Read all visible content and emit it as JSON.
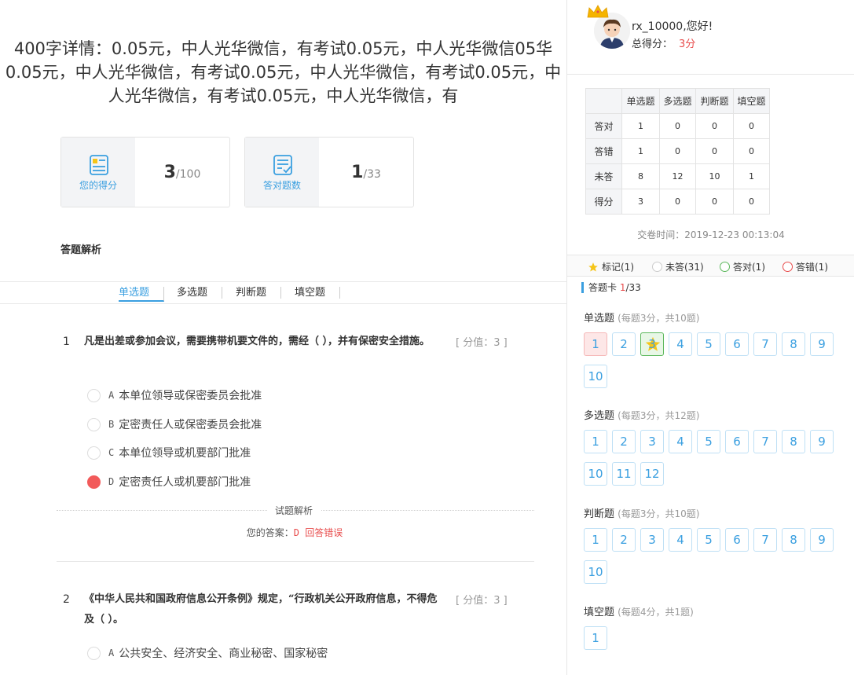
{
  "title": "400字详情：0.05元，中人光华微信，有考试0.05元，中人光华微信05华0.05元，中人光华微信，有考试0.05元，中人光华微信，有考试0.05元，中人光华微信，有考试0.05元，中人光华微信，有",
  "stats": {
    "score": {
      "label": "您的得分",
      "value": "3",
      "total": "/100",
      "icon": "document-icon"
    },
    "correct": {
      "label": "答对题数",
      "value": "1",
      "total": "/33",
      "icon": "checklist-icon"
    }
  },
  "section_title": "答题解析",
  "tabs": [
    "单选题",
    "多选题",
    "判断题",
    "填空题"
  ],
  "questions": [
    {
      "num": "1",
      "text": "凡是出差或参加会议，需要携带机要文件的，需经（ ），并有保密安全措施。",
      "score": "[ 分值：3 ]",
      "options": [
        {
          "letter": "A",
          "text": "本单位领导或保密委员会批准",
          "selected": false
        },
        {
          "letter": "B",
          "text": "定密责任人或保密委员会批准",
          "selected": false
        },
        {
          "letter": "C",
          "text": "本单位领导或机要部门批准",
          "selected": false
        },
        {
          "letter": "D",
          "text": "定密责任人或机要部门批准",
          "selected": true
        }
      ],
      "analysis_label": "试题解析",
      "answer_prefix": "您的答案：",
      "answer_value": "D 回答错误"
    },
    {
      "num": "2",
      "text": "《中华人民共和国政府信息公开条例》规定，“行政机关公开政府信息，不得危及（ ）。",
      "score": "[ 分值：3 ]",
      "options": [
        {
          "letter": "A",
          "text": "公共安全、经济安全、商业秘密、国家秘密",
          "selected": false
        }
      ]
    }
  ],
  "user": {
    "greeting": "rx_10000,您好!",
    "total_label": "总得分：",
    "total_value": "3分"
  },
  "score_table": {
    "headers": [
      "",
      "单选题",
      "多选题",
      "判断题",
      "填空题"
    ],
    "rows": [
      {
        "label": "答对",
        "values": [
          "1",
          "0",
          "0",
          "0"
        ]
      },
      {
        "label": "答错",
        "values": [
          "1",
          "0",
          "0",
          "0"
        ]
      },
      {
        "label": "未答",
        "values": [
          "8",
          "12",
          "10",
          "1"
        ]
      },
      {
        "label": "得分",
        "values": [
          "3",
          "0",
          "0",
          "0"
        ]
      }
    ]
  },
  "submit_time": "交卷时间：2019-12-23 00:13:04",
  "legend": {
    "marked": "标记(1)",
    "unanswered": "未答(31)",
    "correct": "答对(1)",
    "wrong": "答错(1)"
  },
  "answer_card": {
    "label": "答题卡",
    "count": "1",
    "total": "/33"
  },
  "groups": [
    {
      "name": "单选题",
      "sub": "(每题3分，共10题)",
      "items": [
        "1",
        "2",
        "3",
        "4",
        "5",
        "6",
        "7",
        "8",
        "9",
        "10"
      ]
    },
    {
      "name": "多选题",
      "sub": "(每题3分，共12题)",
      "items": [
        "1",
        "2",
        "3",
        "4",
        "5",
        "6",
        "7",
        "8",
        "9",
        "10",
        "11",
        "12"
      ]
    },
    {
      "name": "判断题",
      "sub": "(每题3分，共10题)",
      "items": [
        "1",
        "2",
        "3",
        "4",
        "5",
        "6",
        "7",
        "8",
        "9",
        "10"
      ]
    },
    {
      "name": "填空题",
      "sub": "(每题4分，共1题)",
      "items": [
        "1"
      ]
    }
  ],
  "colors": {
    "accent": "#3a9fe0",
    "wrong": "#e84c4c",
    "correct": "#5cb85c",
    "star": "#f5c518"
  }
}
